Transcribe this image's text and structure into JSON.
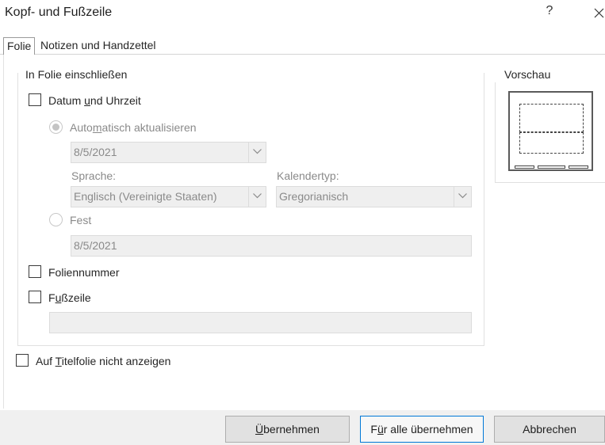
{
  "window": {
    "title": "Kopf- und Fußzeile",
    "help": "?",
    "close": "✕"
  },
  "tabs": [
    {
      "label": "Folie"
    },
    {
      "label": "Notizen und Handzettel"
    }
  ],
  "group": {
    "title": "In Folie einschließen",
    "datum": {
      "label_pre": "Datum ",
      "label_u": "u",
      "label_post": "nd Uhrzeit",
      "checked": false
    },
    "auto": {
      "label_pre": "Auto",
      "label_u": "m",
      "label_post": "atisch aktualisieren",
      "selected": true,
      "date_value": "8/5/2021"
    },
    "sprache": {
      "label": "Sprache:",
      "value": "Englisch (Vereinigte Staaten)"
    },
    "kalender": {
      "label": "Kalendertyp:",
      "value": "Gregorianisch"
    },
    "fest": {
      "label": "Fest",
      "value": "8/5/2021",
      "selected": false
    },
    "foliennummer": {
      "label": "Foliennummer",
      "checked": false
    },
    "fusszeile": {
      "label_pre": "F",
      "label_u": "u",
      "label_post": "ßzeile",
      "checked": false,
      "value": ""
    }
  },
  "titelfolie": {
    "label_pre": "Auf ",
    "label_u": "T",
    "label_post": "itelfolie nicht anzeigen",
    "checked": false
  },
  "preview": {
    "title": "Vorschau"
  },
  "buttons": {
    "apply": {
      "label_pre": "",
      "label_u": "Ü",
      "label_post": "bernehmen"
    },
    "apply_all": {
      "label_pre": "F",
      "label_u": "ü",
      "label_post": "r alle übernehmen"
    },
    "cancel": {
      "label": "Abbrechen"
    }
  },
  "colors": {
    "accent": "#0078d7",
    "disabled_text": "#8a8a8a",
    "field_bg": "#efefef"
  }
}
